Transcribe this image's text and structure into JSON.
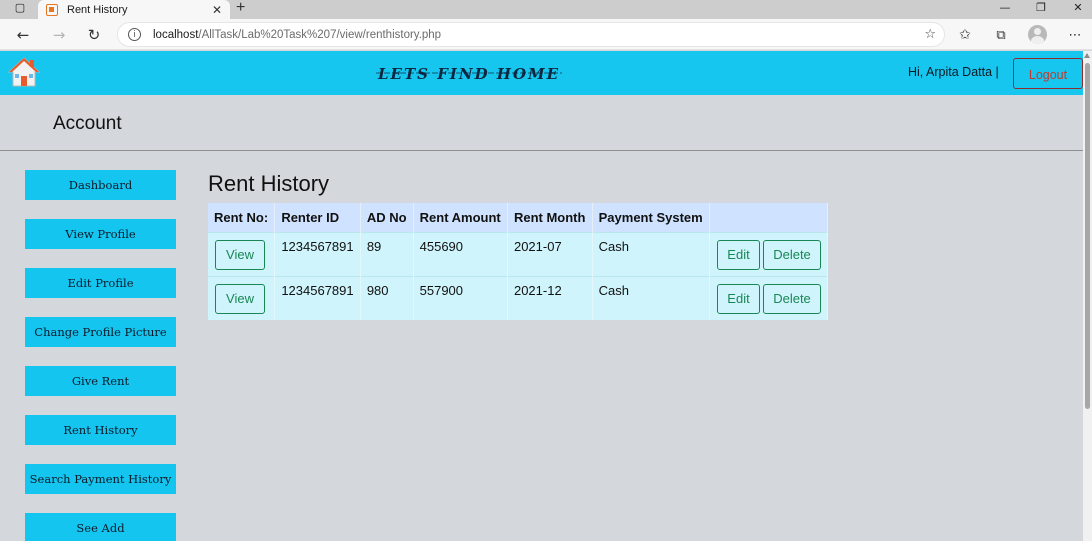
{
  "browser": {
    "tab_title": "Rent History",
    "tab_close": "✕",
    "new_tab": "+",
    "url_host": "localhost",
    "url_path": "/AllTask/Lab%20Task%207/view/renthistory.php"
  },
  "header": {
    "brand": "Lets Find Home",
    "greeting": "Hi, Arpita Datta  |",
    "logout_label": "Logout"
  },
  "account": {
    "title": "Account"
  },
  "sidebar": {
    "items": [
      {
        "label": "Dashboard"
      },
      {
        "label": "View Profile"
      },
      {
        "label": "Edit Profile"
      },
      {
        "label": "Change Profile Picture"
      },
      {
        "label": "Give Rent"
      },
      {
        "label": "Rent History"
      },
      {
        "label": "Search Payment History"
      },
      {
        "label": "See Add"
      }
    ]
  },
  "main": {
    "heading": "Rent History",
    "columns": [
      "Rent No:",
      "Renter ID",
      "AD No",
      "Rent Amount",
      "Rent Month",
      "Payment System",
      ""
    ],
    "rows": [
      {
        "view": "View",
        "renter_id": "1234567891",
        "ad_no": "89",
        "amount": "455690",
        "month": "2021-07",
        "payment": "Cash",
        "edit": "Edit",
        "delete": "Delete"
      },
      {
        "view": "View",
        "renter_id": "1234567891",
        "ad_no": "980",
        "amount": "557900",
        "month": "2021-12",
        "payment": "Cash",
        "edit": "Edit",
        "delete": "Delete"
      }
    ]
  },
  "colors": {
    "header_bg": "#17c6ee",
    "page_bg": "#d4d7dc",
    "table_head": "#cfe2ff",
    "table_row": "#cff4fc",
    "outline_success": "#198754",
    "logout_text": "#c0392b"
  },
  "icons": {
    "home": "home-icon",
    "back": "back-arrow-icon",
    "forward": "forward-arrow-icon",
    "refresh": "refresh-icon",
    "info": "info-icon",
    "favorites_add": "star-add-icon",
    "favorites": "favorites-icon",
    "collections": "collections-icon",
    "profile": "profile-icon",
    "more": "more-icon"
  }
}
